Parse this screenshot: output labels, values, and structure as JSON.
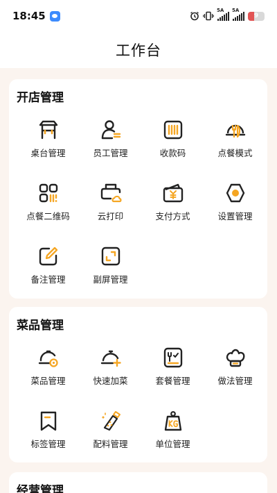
{
  "status_bar": {
    "time": "18:45",
    "signal1_label": "5A",
    "signal2_label": "5A",
    "battery": "9"
  },
  "header": {
    "title": "工作台"
  },
  "sections": [
    {
      "title": "开店管理",
      "items": [
        {
          "label": "桌台管理",
          "icon": "table-icon"
        },
        {
          "label": "员工管理",
          "icon": "staff-icon"
        },
        {
          "label": "收款码",
          "icon": "payment-code-icon"
        },
        {
          "label": "点餐模式",
          "icon": "order-mode-icon"
        },
        {
          "label": "点餐二维码",
          "icon": "qr-code-icon"
        },
        {
          "label": "云打印",
          "icon": "cloud-print-icon"
        },
        {
          "label": "支付方式",
          "icon": "wallet-icon"
        },
        {
          "label": "设置管理",
          "icon": "settings-icon"
        },
        {
          "label": "备注管理",
          "icon": "note-edit-icon"
        },
        {
          "label": "副屏管理",
          "icon": "second-screen-icon"
        }
      ]
    },
    {
      "title": "菜品管理",
      "items": [
        {
          "label": "菜品管理",
          "icon": "dish-cover-icon"
        },
        {
          "label": "快速加菜",
          "icon": "quick-add-dish-icon"
        },
        {
          "label": "套餐管理",
          "icon": "set-meal-icon"
        },
        {
          "label": "做法管理",
          "icon": "chef-hat-icon"
        },
        {
          "label": "标签管理",
          "icon": "bookmark-tag-icon"
        },
        {
          "label": "配料管理",
          "icon": "ingredient-icon"
        },
        {
          "label": "单位管理",
          "icon": "unit-kg-icon"
        }
      ]
    },
    {
      "title": "经营管理",
      "items": []
    }
  ],
  "colors": {
    "accent": "#f5a623",
    "icon_stroke": "#222222",
    "background": "#fbf4ef"
  }
}
